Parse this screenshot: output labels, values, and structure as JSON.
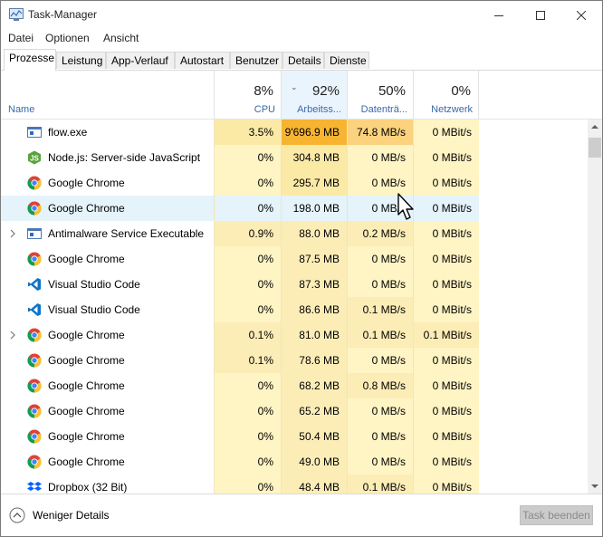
{
  "window": {
    "title": "Task-Manager"
  },
  "menu": [
    "Datei",
    "Optionen",
    "Ansicht"
  ],
  "tabs": [
    "Prozesse",
    "Leistung",
    "App-Verlauf",
    "Autostart",
    "Benutzer",
    "Details",
    "Dienste"
  ],
  "active_tab": "Prozesse",
  "columns": {
    "name": {
      "label": "Name"
    },
    "cpu": {
      "percent": "8%",
      "label": "CPU"
    },
    "memory": {
      "percent": "92%",
      "label": "Arbeitss...",
      "sorted": true
    },
    "disk": {
      "percent": "50%",
      "label": "Datenträ..."
    },
    "network": {
      "percent": "0%",
      "label": "Netzwerk"
    }
  },
  "rows": [
    {
      "name": "flow.exe",
      "icon": "app-window-icon",
      "expandable": false,
      "selected": false,
      "cpu": "3.5%",
      "mem": "9'696.9 MB",
      "disk": "74.8 MB/s",
      "net": "0 MBit/s",
      "cpu_heat": "#fbe9a6",
      "mem_heat": "#f7b431",
      "disk_heat": "#fbd27d",
      "net_heat": "#fff4c4"
    },
    {
      "name": "Node.js: Server-side JavaScript",
      "icon": "nodejs-icon",
      "expandable": false,
      "selected": false,
      "cpu": "0%",
      "mem": "304.8 MB",
      "disk": "0 MB/s",
      "net": "0 MBit/s",
      "cpu_heat": "#fff4c4",
      "mem_heat": "#fbe9a6",
      "disk_heat": "#fff4c4",
      "net_heat": "#fff4c4"
    },
    {
      "name": "Google Chrome",
      "icon": "chrome-icon",
      "expandable": false,
      "selected": false,
      "cpu": "0%",
      "mem": "295.7 MB",
      "disk": "0 MB/s",
      "net": "0 MBit/s",
      "cpu_heat": "#fff4c4",
      "mem_heat": "#fbe9a6",
      "disk_heat": "#fff4c4",
      "net_heat": "#fff4c4"
    },
    {
      "name": "Google Chrome",
      "icon": "chrome-icon",
      "expandable": false,
      "selected": true,
      "cpu": "0%",
      "mem": "198.0 MB",
      "disk": "0 MB/s",
      "net": "0 MBit/s",
      "cpu_heat": "#e5f3fb",
      "mem_heat": "#e5f3fb",
      "disk_heat": "#e5f3fb",
      "net_heat": "#e5f3fb"
    },
    {
      "name": "Antimalware Service Executable",
      "icon": "app-window-icon",
      "expandable": true,
      "selected": false,
      "cpu": "0.9%",
      "mem": "88.0 MB",
      "disk": "0.2 MB/s",
      "net": "0 MBit/s",
      "cpu_heat": "#fcedb7",
      "mem_heat": "#fcedb7",
      "disk_heat": "#fcedb7",
      "net_heat": "#fff4c4"
    },
    {
      "name": "Google Chrome",
      "icon": "chrome-icon",
      "expandable": false,
      "selected": false,
      "cpu": "0%",
      "mem": "87.5 MB",
      "disk": "0 MB/s",
      "net": "0 MBit/s",
      "cpu_heat": "#fff4c4",
      "mem_heat": "#fcedb7",
      "disk_heat": "#fff4c4",
      "net_heat": "#fff4c4"
    },
    {
      "name": "Visual Studio Code",
      "icon": "vscode-icon",
      "expandable": false,
      "selected": false,
      "cpu": "0%",
      "mem": "87.3 MB",
      "disk": "0 MB/s",
      "net": "0 MBit/s",
      "cpu_heat": "#fff4c4",
      "mem_heat": "#fcedb7",
      "disk_heat": "#fff4c4",
      "net_heat": "#fff4c4"
    },
    {
      "name": "Visual Studio Code",
      "icon": "vscode-icon",
      "expandable": false,
      "selected": false,
      "cpu": "0%",
      "mem": "86.6 MB",
      "disk": "0.1 MB/s",
      "net": "0 MBit/s",
      "cpu_heat": "#fff4c4",
      "mem_heat": "#fcedb7",
      "disk_heat": "#fcedb7",
      "net_heat": "#fff4c4"
    },
    {
      "name": "Google Chrome",
      "icon": "chrome-icon",
      "expandable": true,
      "selected": false,
      "cpu": "0.1%",
      "mem": "81.0 MB",
      "disk": "0.1 MB/s",
      "net": "0.1 MBit/s",
      "cpu_heat": "#fcedb7",
      "mem_heat": "#fcedb7",
      "disk_heat": "#fcedb7",
      "net_heat": "#fcedb7"
    },
    {
      "name": "Google Chrome",
      "icon": "chrome-icon",
      "expandable": false,
      "selected": false,
      "cpu": "0.1%",
      "mem": "78.6 MB",
      "disk": "0 MB/s",
      "net": "0 MBit/s",
      "cpu_heat": "#fcedb7",
      "mem_heat": "#fcedb7",
      "disk_heat": "#fff4c4",
      "net_heat": "#fff4c4"
    },
    {
      "name": "Google Chrome",
      "icon": "chrome-icon",
      "expandable": false,
      "selected": false,
      "cpu": "0%",
      "mem": "68.2 MB",
      "disk": "0.8 MB/s",
      "net": "0 MBit/s",
      "cpu_heat": "#fff4c4",
      "mem_heat": "#fcedb7",
      "disk_heat": "#fcedb7",
      "net_heat": "#fff4c4"
    },
    {
      "name": "Google Chrome",
      "icon": "chrome-icon",
      "expandable": false,
      "selected": false,
      "cpu": "0%",
      "mem": "65.2 MB",
      "disk": "0 MB/s",
      "net": "0 MBit/s",
      "cpu_heat": "#fff4c4",
      "mem_heat": "#fcedb7",
      "disk_heat": "#fff4c4",
      "net_heat": "#fff4c4"
    },
    {
      "name": "Google Chrome",
      "icon": "chrome-icon",
      "expandable": false,
      "selected": false,
      "cpu": "0%",
      "mem": "50.4 MB",
      "disk": "0 MB/s",
      "net": "0 MBit/s",
      "cpu_heat": "#fff4c4",
      "mem_heat": "#fcedb7",
      "disk_heat": "#fff4c4",
      "net_heat": "#fff4c4"
    },
    {
      "name": "Google Chrome",
      "icon": "chrome-icon",
      "expandable": false,
      "selected": false,
      "cpu": "0%",
      "mem": "49.0 MB",
      "disk": "0 MB/s",
      "net": "0 MBit/s",
      "cpu_heat": "#fff4c4",
      "mem_heat": "#fcedb7",
      "disk_heat": "#fff4c4",
      "net_heat": "#fff4c4"
    },
    {
      "name": "Dropbox (32 Bit)",
      "icon": "dropbox-icon",
      "expandable": false,
      "selected": false,
      "cpu": "0%",
      "mem": "48.4 MB",
      "disk": "0.1 MB/s",
      "net": "0 MBit/s",
      "cpu_heat": "#fff4c4",
      "mem_heat": "#fcedb7",
      "disk_heat": "#fcedb7",
      "net_heat": "#fff4c4"
    }
  ],
  "footer": {
    "less_details": "Weniger Details",
    "end_task": "Task beenden"
  },
  "colors": {
    "header_label": "#3a6aa8",
    "selected_row": "#e5f3fb",
    "heat_low": "#fff4c4",
    "heat_mid": "#fcedb7",
    "heat_high": "#f7b431"
  }
}
